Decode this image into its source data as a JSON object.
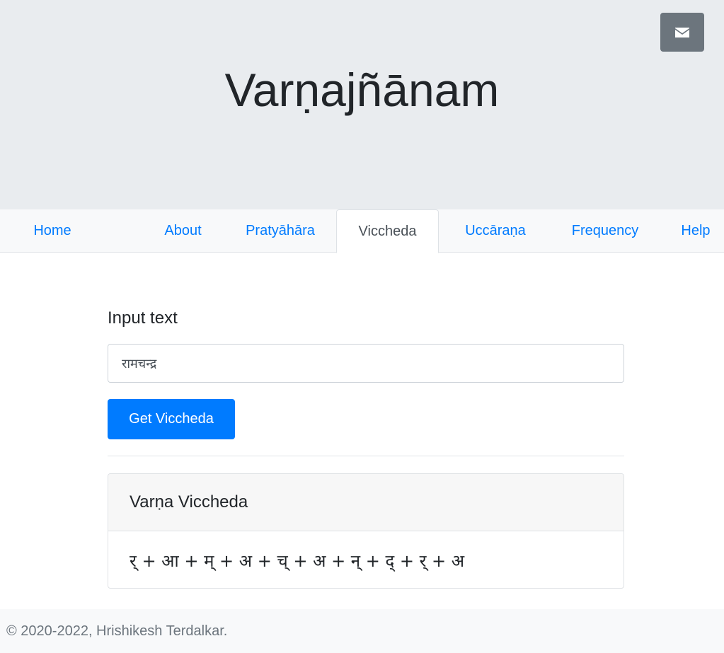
{
  "header": {
    "title": "Varṇajñānam",
    "contact_icon": "envelope-icon"
  },
  "nav": {
    "items": [
      {
        "label": "Home"
      },
      {
        "label": "About"
      },
      {
        "label": "Pratyāhāra"
      },
      {
        "label": "Viccheda"
      },
      {
        "label": "Uccāraṇa"
      },
      {
        "label": "Frequency"
      },
      {
        "label": "Help"
      }
    ],
    "active": "Viccheda"
  },
  "form": {
    "label": "Input text",
    "input_value": "रामचन्द्र",
    "button_label": "Get Viccheda"
  },
  "result": {
    "title": "Varṇa Viccheda",
    "value": "र् + आ + म् + अ + च् + अ + न् + द् + र् + अ"
  },
  "footer": {
    "text": "© 2020-2022, Hrishikesh Terdalkar."
  },
  "colors": {
    "primary": "#007bff",
    "secondary": "#6c757d",
    "jumbotron": "#e9ecef",
    "nav_background": "#f8f9fa"
  }
}
